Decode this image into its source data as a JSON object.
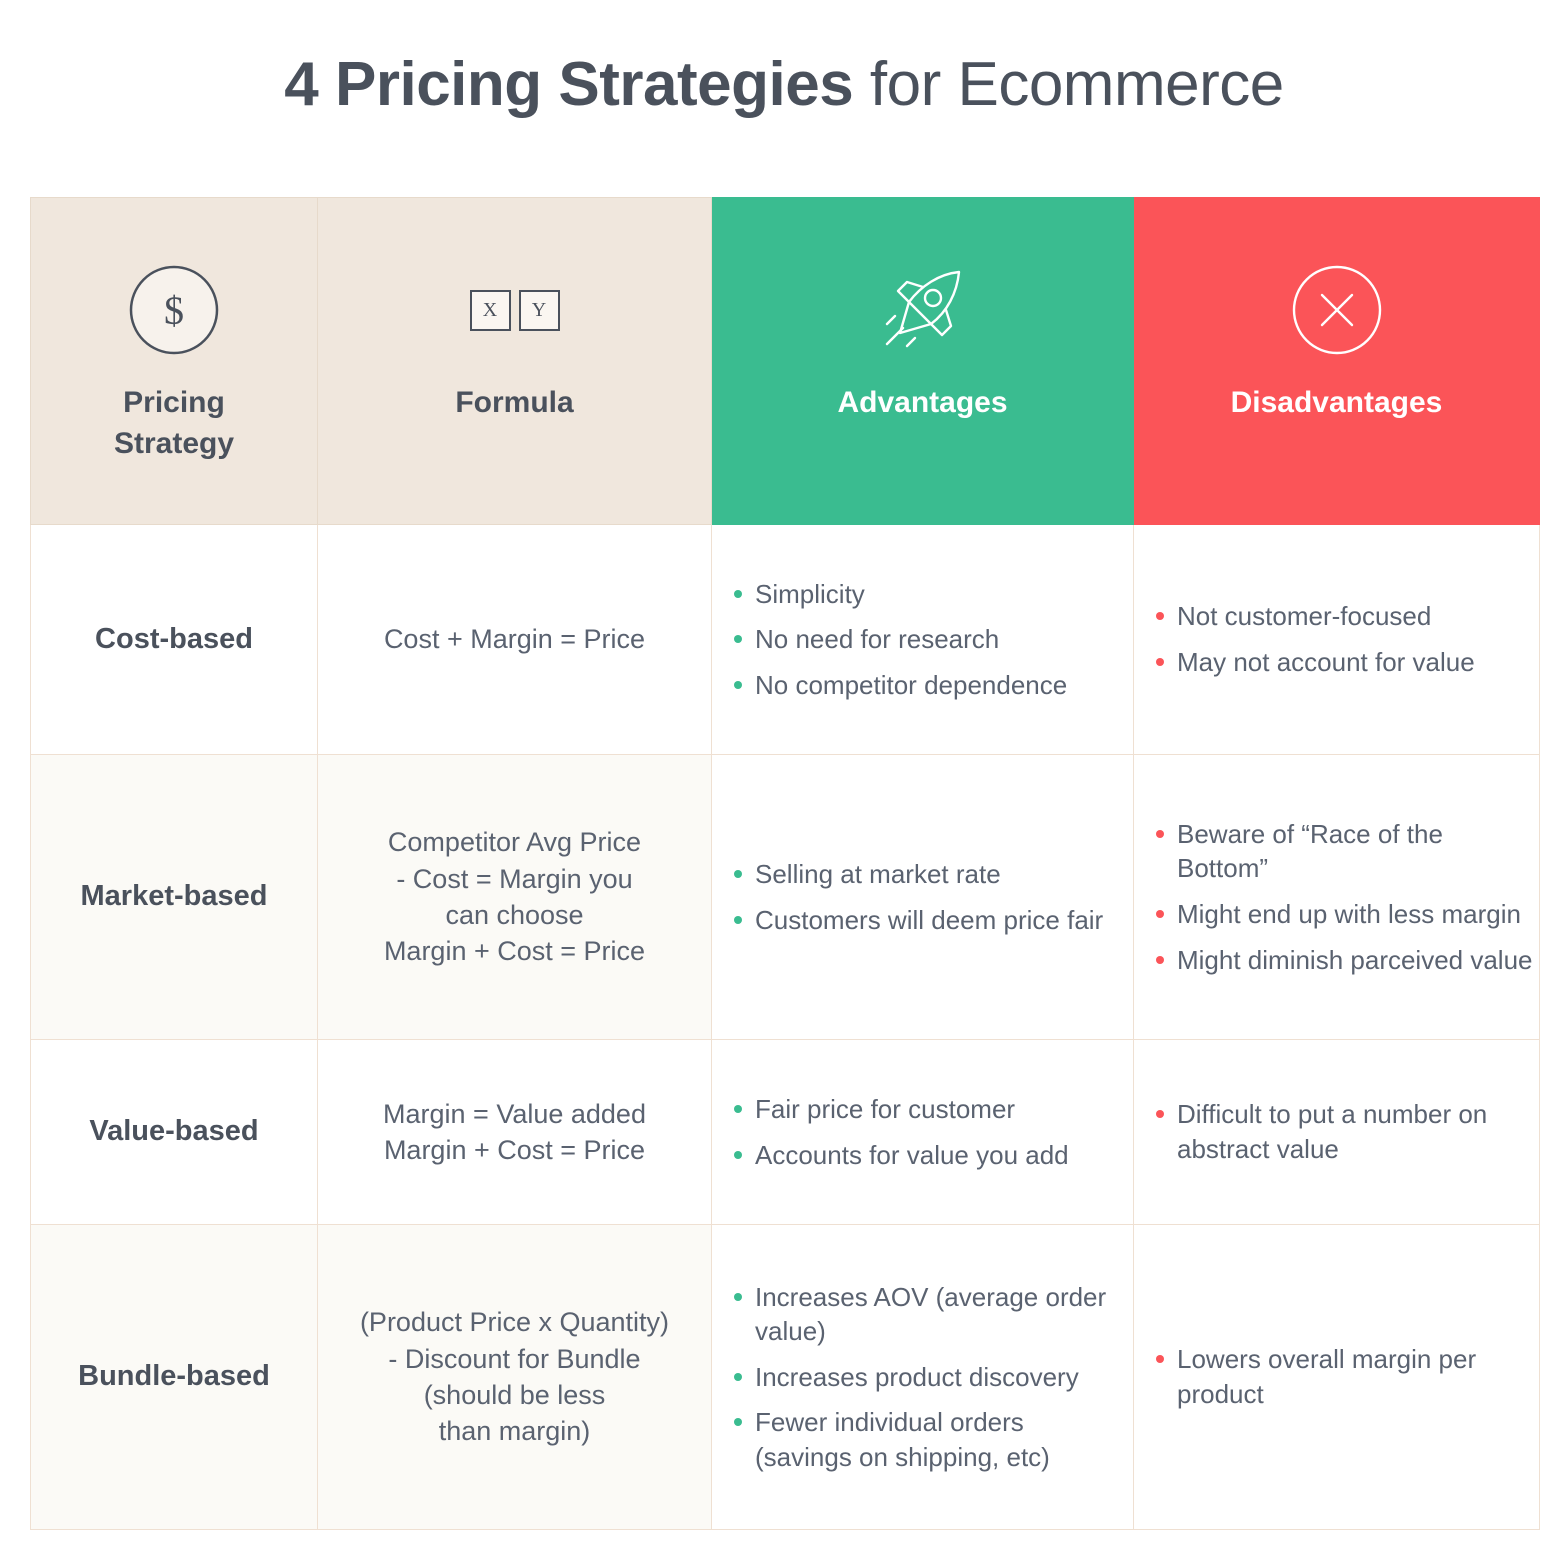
{
  "title": {
    "bold_part": "4 Pricing Strategies",
    "light_part": " for Ecommerce"
  },
  "colors": {
    "advantages_header_bg": "#3ABC90",
    "disadvantages_header_bg": "#FB5458",
    "strategy_header_bg": "#F0E7DD",
    "formula_header_bg": "#F0E7DD",
    "text_dark": "#4A515C",
    "text_body": "#5A6270",
    "border": "#EFE0D2",
    "advantages_cell_bg": "#F0F8F5",
    "disadvantages_cell_bg": "#FDF0EF"
  },
  "table": {
    "headers": [
      {
        "label": "Pricing\nStrategy",
        "label_line1": "Pricing",
        "label_line2": "Strategy",
        "icon": "dollar-circle-icon",
        "style": "beige"
      },
      {
        "label": "Formula",
        "icon": "xy-boxes-icon",
        "style": "beige"
      },
      {
        "label": "Advantages",
        "icon": "rocket-icon",
        "style": "green"
      },
      {
        "label": "Disadvantages",
        "icon": "x-circle-icon",
        "style": "red"
      }
    ],
    "xy_icon": {
      "x_label": "X",
      "y_label": "Y"
    },
    "rows": [
      {
        "strategy": "Cost-based",
        "formula_lines": [
          "Cost + Margin = Price"
        ],
        "advantages": [
          "Simplicity",
          "No need for research",
          "No competitor dependence"
        ],
        "disadvantages": [
          "Not customer-focused",
          "May not account for value"
        ]
      },
      {
        "strategy": "Market-based",
        "formula_lines": [
          "Competitor Avg Price",
          "- Cost = Margin you",
          "can choose",
          "Margin + Cost = Price"
        ],
        "advantages": [
          "Selling at market rate",
          "Customers will deem price fair"
        ],
        "disadvantages": [
          "Beware of “Race of the Bottom”",
          "Might end up with less margin",
          "Might diminish parceived value"
        ]
      },
      {
        "strategy": "Value-based",
        "formula_lines": [
          "Margin = Value added",
          "Margin + Cost = Price"
        ],
        "advantages": [
          "Fair price for customer",
          "Accounts for value you add"
        ],
        "disadvantages": [
          "Difficult to put a number on abstract value"
        ]
      },
      {
        "strategy": "Bundle-based",
        "formula_lines": [
          "(Product Price x Quantity)",
          "- Discount for Bundle",
          "(should be less",
          "than margin)"
        ],
        "advantages": [
          "Increases AOV (average order value)",
          "Increases product discovery",
          "Fewer individual orders (savings on shipping, etc)"
        ],
        "disadvantages": [
          "Lowers overall margin per product"
        ]
      }
    ]
  }
}
